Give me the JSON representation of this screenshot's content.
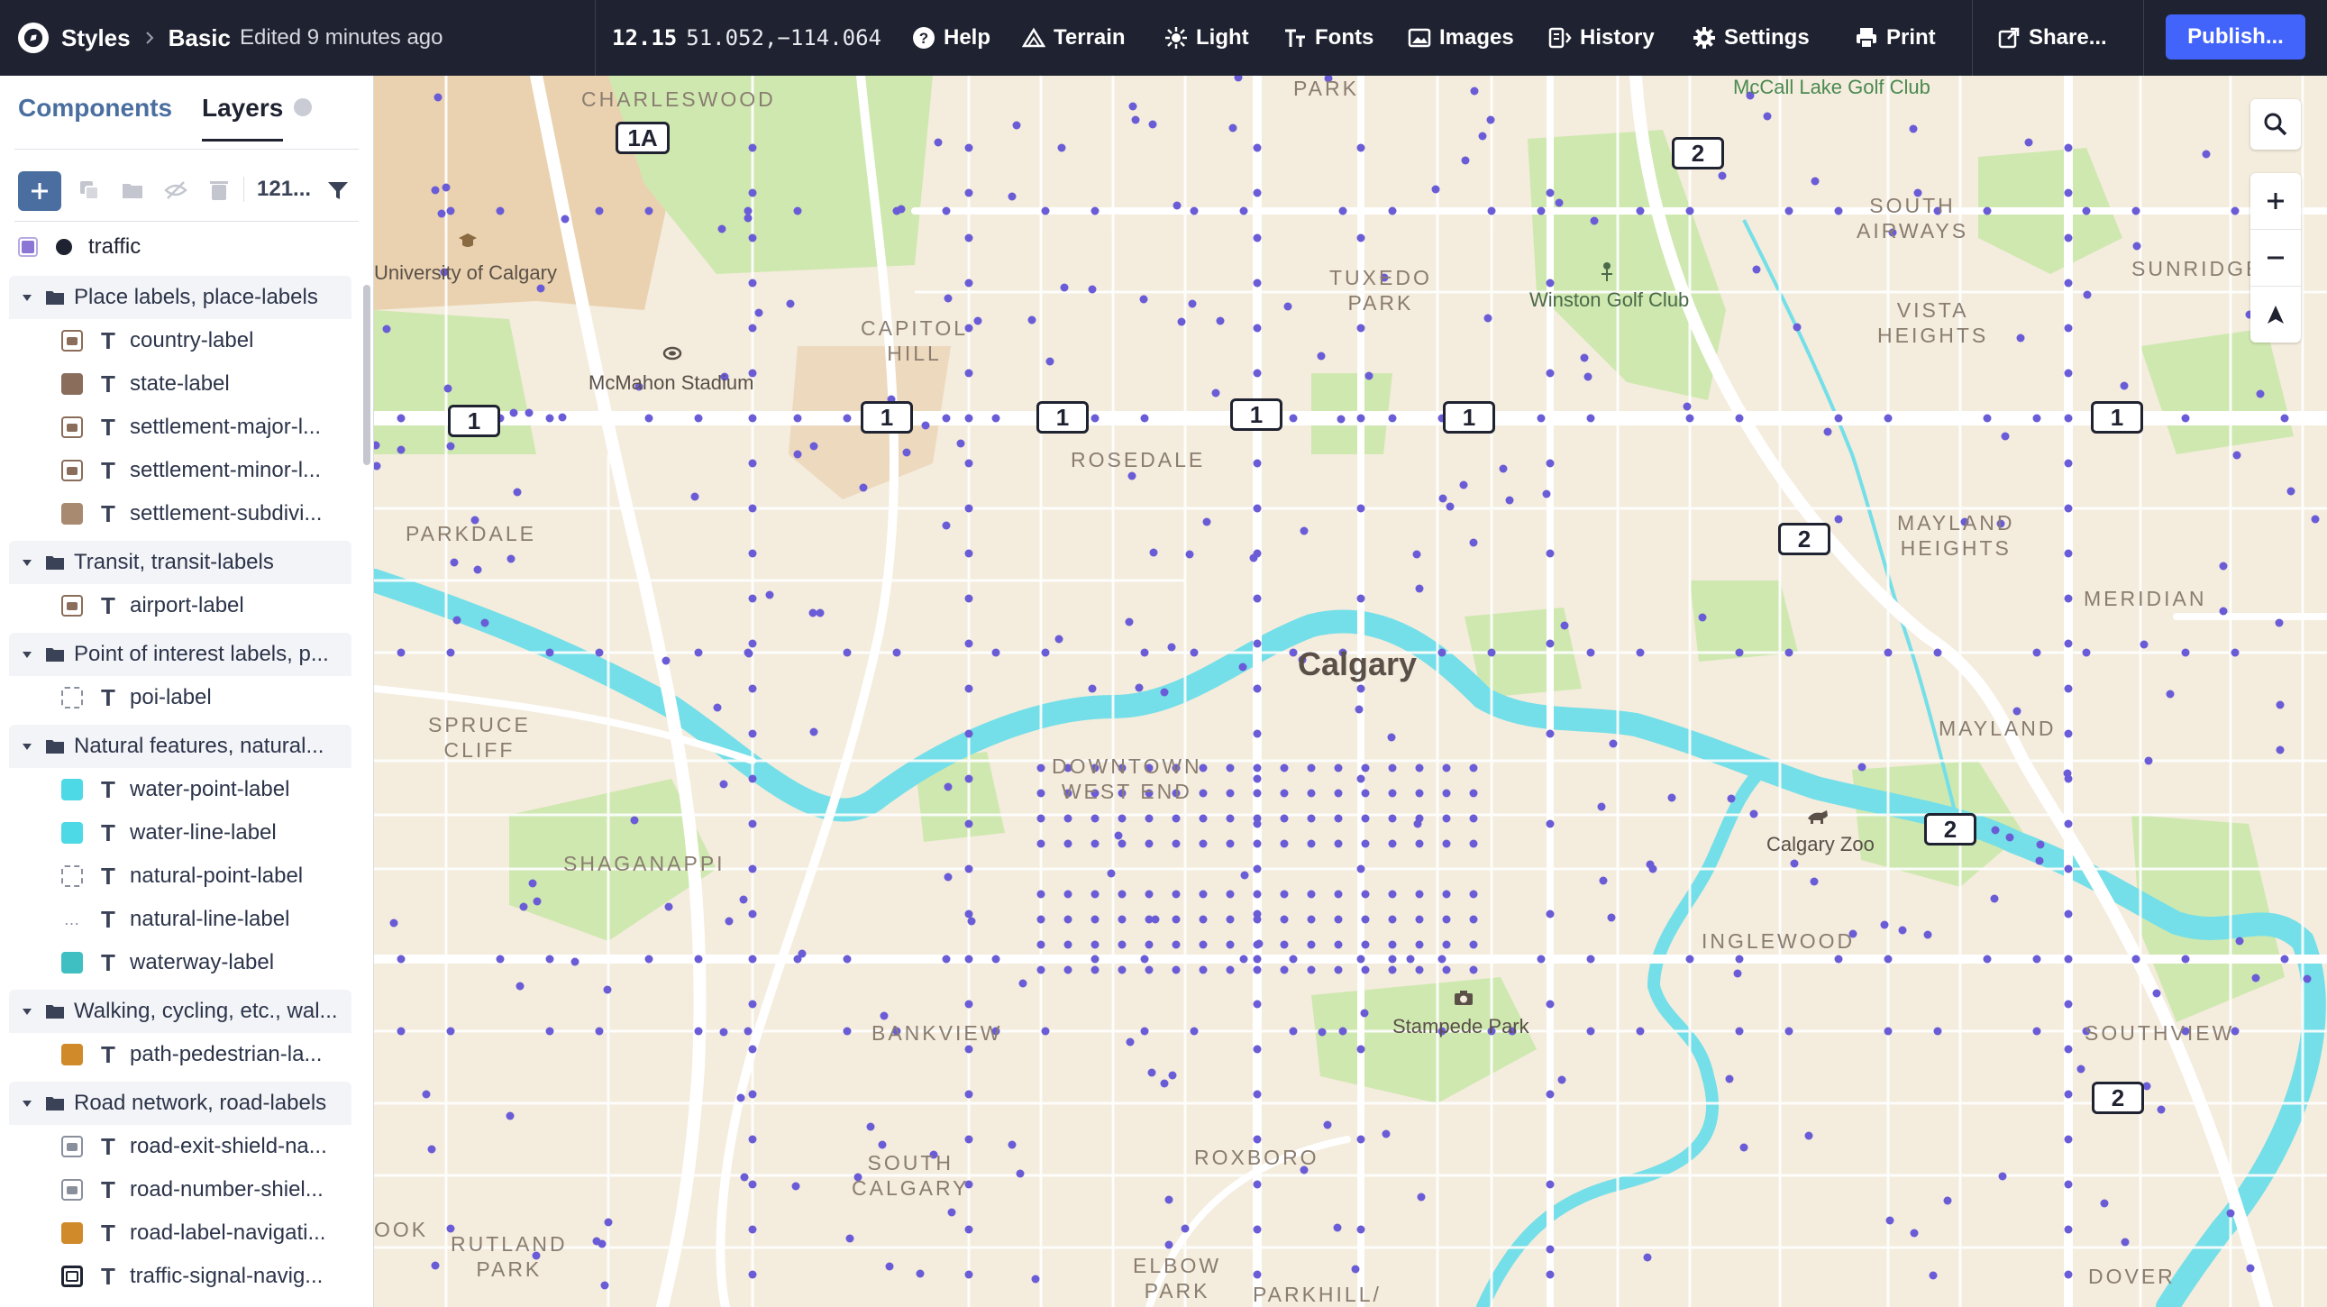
{
  "topbar": {
    "styles_label": "Styles",
    "style_name": "Basic",
    "edited": "Edited 9 minutes ago",
    "zoom": "12.15",
    "center": "51.052,−114.064",
    "menu": {
      "help": "Help",
      "terrain": "Terrain",
      "light": "Light",
      "fonts": "Fonts",
      "images": "Images",
      "history": "History",
      "settings": "Settings",
      "print": "Print",
      "share": "Share...",
      "publish": "Publish..."
    }
  },
  "sidebar": {
    "tabs": {
      "components": "Components",
      "layers": "Layers"
    },
    "layer_count": "121...",
    "traffic": "traffic",
    "groups": [
      {
        "label": "Place labels, place-labels",
        "layers": [
          {
            "name": "country-label",
            "swatch": "icon",
            "color": "#8a6d5a"
          },
          {
            "name": "state-label",
            "swatch": "fill",
            "color": "#8a6d5a"
          },
          {
            "name": "settlement-major-l...",
            "swatch": "icon",
            "color": "#8a6d5a"
          },
          {
            "name": "settlement-minor-l...",
            "swatch": "icon",
            "color": "#8a6d5a"
          },
          {
            "name": "settlement-subdivi...",
            "swatch": "fill",
            "color": "#a78a70"
          }
        ]
      },
      {
        "label": "Transit, transit-labels",
        "layers": [
          {
            "name": "airport-label",
            "swatch": "icon",
            "color": "#8a6d5a"
          }
        ]
      },
      {
        "label": "Point of interest labels, p...",
        "layers": [
          {
            "name": "poi-label",
            "swatch": "dashed",
            "color": "#8a8f9c"
          }
        ]
      },
      {
        "label": "Natural features, natural...",
        "layers": [
          {
            "name": "water-point-label",
            "swatch": "fill",
            "color": "#4dd9e6"
          },
          {
            "name": "water-line-label",
            "swatch": "fill",
            "color": "#4dd9e6"
          },
          {
            "name": "natural-point-label",
            "swatch": "dashed",
            "color": "#8a8f9c"
          },
          {
            "name": "natural-line-label",
            "swatch": "dots",
            "color": "#8a8f9c"
          },
          {
            "name": "waterway-label",
            "swatch": "fill",
            "color": "#3fbfc2"
          }
        ]
      },
      {
        "label": "Walking, cycling, etc., wal...",
        "layers": [
          {
            "name": "path-pedestrian-la...",
            "swatch": "fill",
            "color": "#d08a2a"
          }
        ]
      },
      {
        "label": "Road network, road-labels",
        "layers": [
          {
            "name": "road-exit-shield-na...",
            "swatch": "icon",
            "color": "#8a8f9c"
          },
          {
            "name": "road-number-shiel...",
            "swatch": "icon",
            "color": "#8a8f9c"
          },
          {
            "name": "road-label-navigati...",
            "swatch": "fill",
            "color": "#d08a2a"
          },
          {
            "name": "traffic-signal-navig...",
            "swatch": "icon-dark",
            "color": "#1f2230"
          }
        ]
      }
    ]
  },
  "map": {
    "labels": {
      "charleswood": "CHARLESWOOD",
      "park_top": "PARK",
      "mccall": "McCall Lake Golf Club",
      "south_airways": "SOUTH\nAIRWAYS",
      "sunridge": "SUNRIDGE",
      "university": "University of Calgary",
      "tuxedo": "TUXEDO\nPARK",
      "winston": "Winston Golf Club",
      "vista": "VISTA\nHEIGHTS",
      "capitol": "CAPITOL\nHILL",
      "mcmahon": "McMahon Stadium",
      "rosedale": "ROSEDALE",
      "parkdale": "PARKDALE",
      "mayland_heights": "MAYLAND\nHEIGHTS",
      "meridian": "MERIDIAN",
      "calgary": "Calgary",
      "spruce": "SPRUCE\nCLIFF",
      "downtown": "DOWNTOWN\nWEST END",
      "mayland": "MAYLAND",
      "calgary_zoo": "Calgary Zoo",
      "shaganappi": "SHAGANAPPI",
      "inglewood": "INGLEWOOD",
      "stampede": "Stampede Park",
      "bankview": "BANKVIEW",
      "southview": "SOUTHVIEW",
      "south_calgary": "SOUTH\nCALGARY",
      "roxboro": "ROXBORO",
      "rutland": "RUTLAND\nPARK",
      "elbow": "ELBOW\nPARK",
      "parkhill": "PARKHILL/",
      "dover": "DOVER",
      "ook": "OOK"
    },
    "shields": {
      "s1a": "1A",
      "s1_a": "1",
      "s1_b": "1",
      "s1_c": "1",
      "s1_d": "1",
      "s1_e": "1",
      "s1_f": "1",
      "s2_a": "2",
      "s2_b": "2",
      "s2_c": "2",
      "s2_d": "2"
    },
    "colors": {
      "land": "#f4ecdd",
      "park": "#cfe8b0",
      "water": "#74dfe8",
      "road": "#ffffff",
      "traffic_dot": "#6a5cd6",
      "campus": "#ead2b0"
    }
  }
}
